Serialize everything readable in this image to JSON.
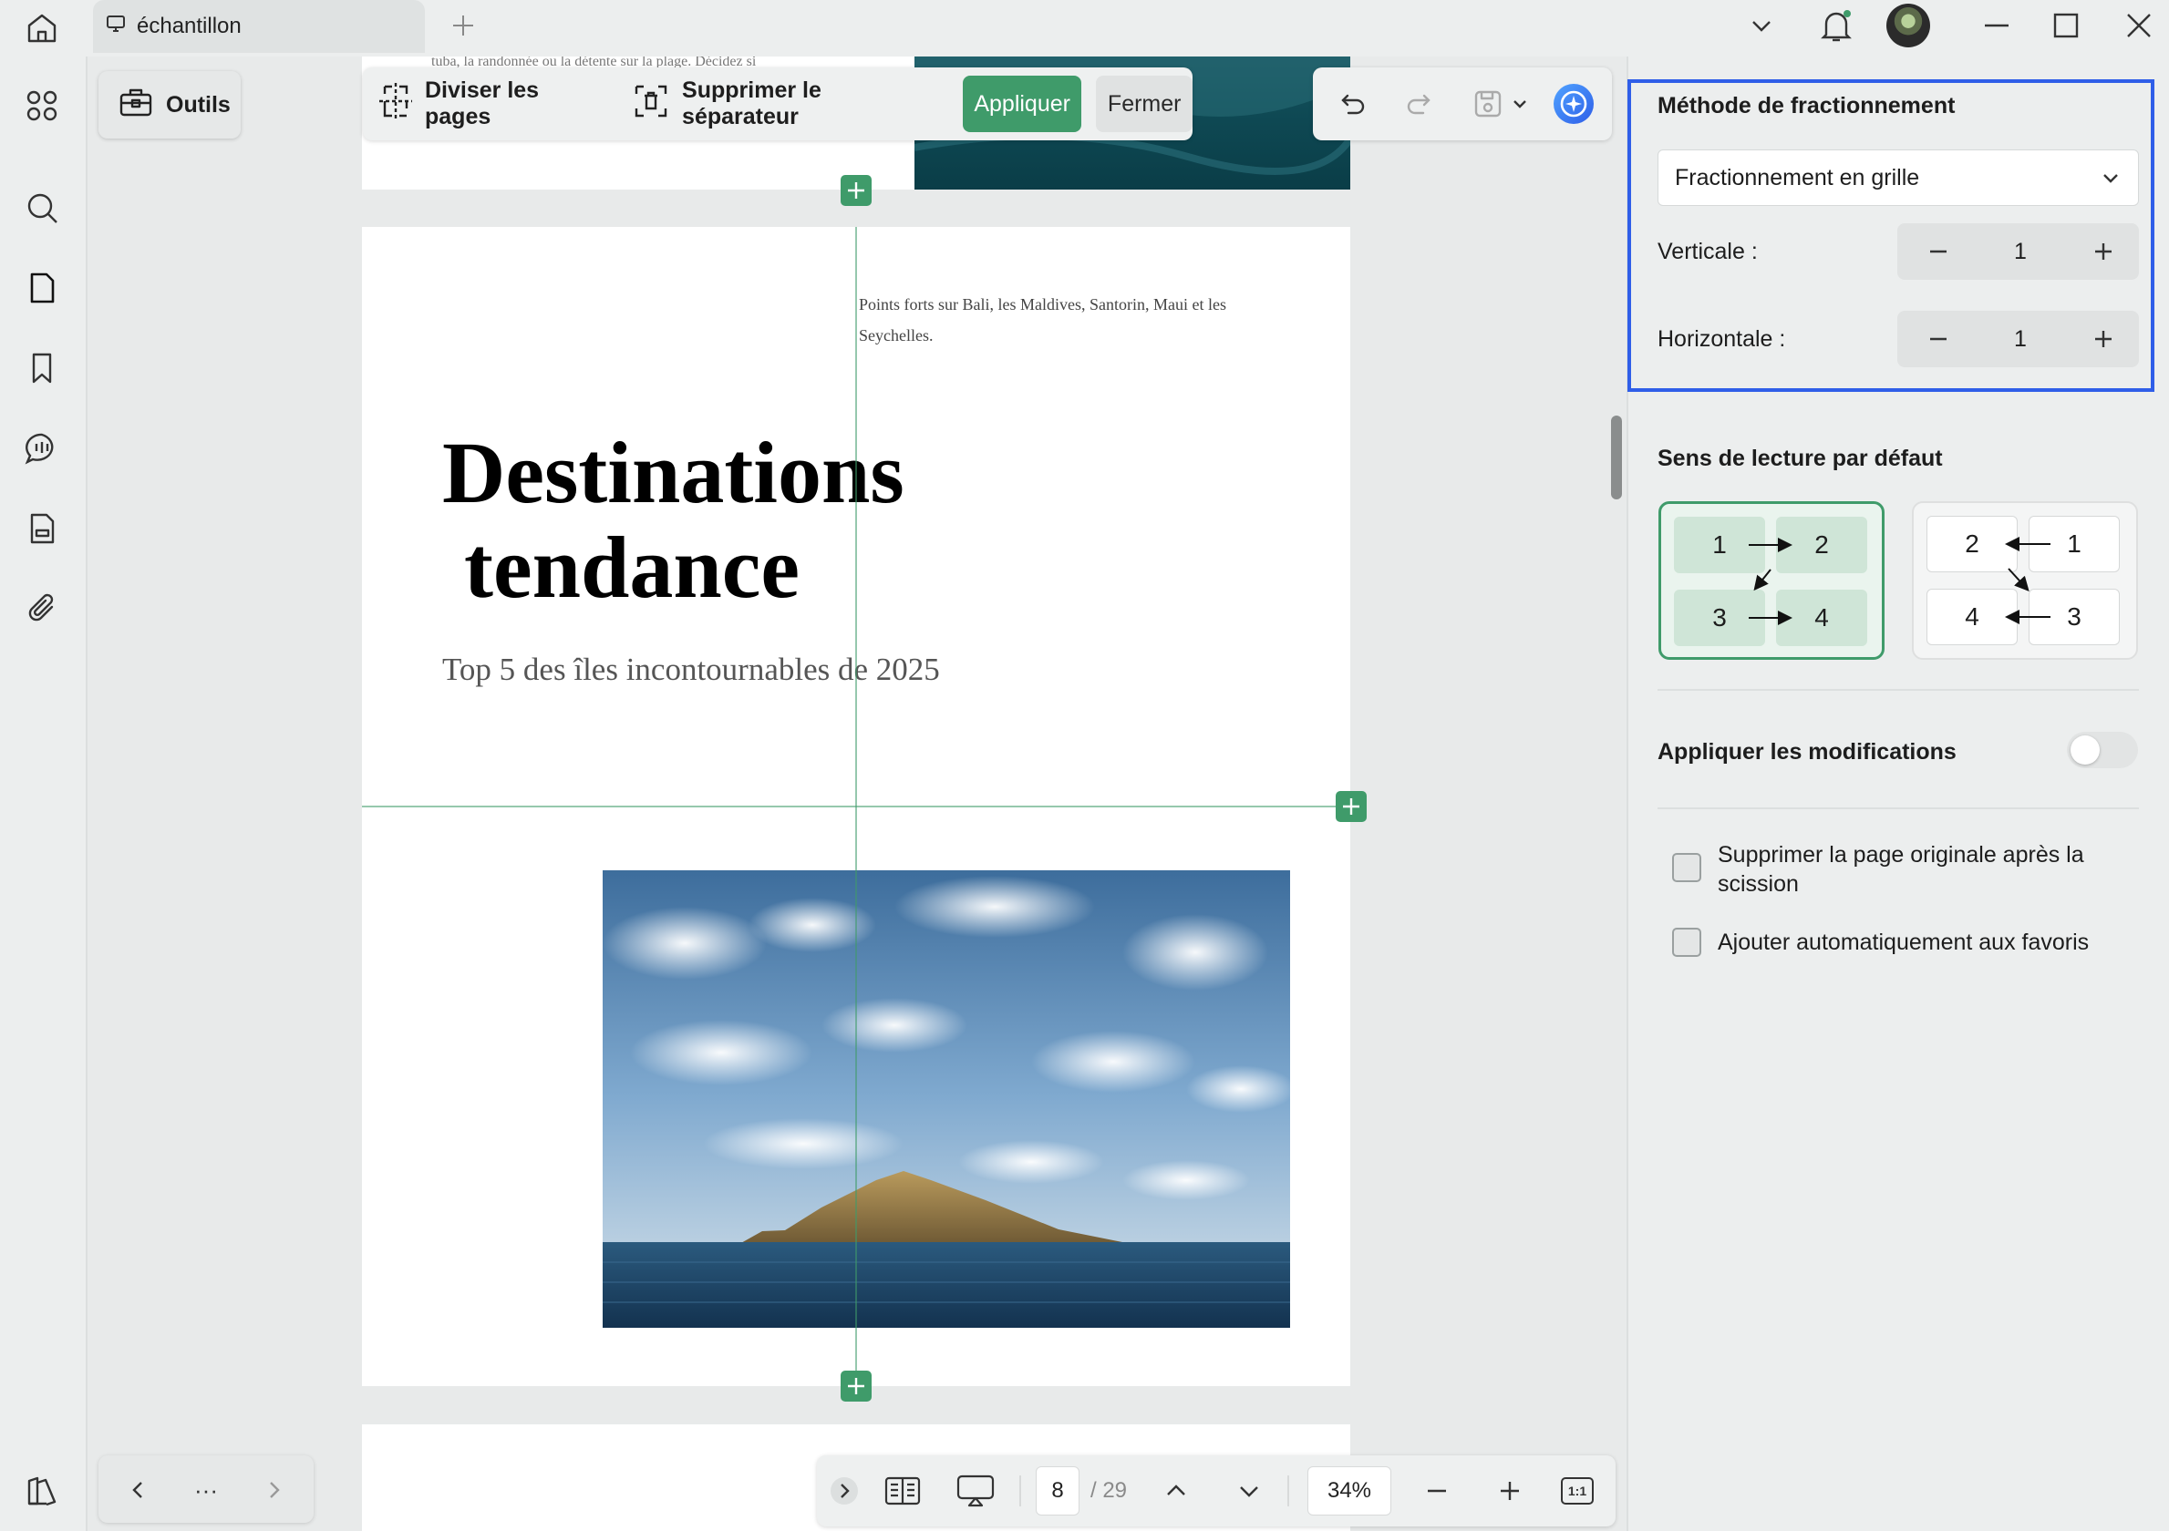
{
  "titlebar": {
    "tab_title": "échantillon"
  },
  "toolbar": {
    "tools_label": "Outils",
    "split_pages_label": "Diviser les pages",
    "remove_separator_label": "Supprimer le séparateur",
    "apply_label": "Appliquer",
    "close_label": "Fermer"
  },
  "document": {
    "top_page_snippet": "tuba, la randonnée ou la détente sur la plage. Décidez si",
    "top_note": "Points forts sur Bali, les Maldives, Santorin, Maui et les Seychelles.",
    "title_line1": "Destinations",
    "title_line2": "tendance",
    "subtitle": "Top 5 des îles incontournables de 2025"
  },
  "status": {
    "page_current": "8",
    "page_total": "/ 29",
    "zoom": "34%",
    "fit_label": "1:1"
  },
  "nav": {
    "more_label": "···"
  },
  "panel": {
    "split_method_heading": "Méthode de fractionnement",
    "split_method_value": "Fractionnement en grille",
    "vertical_label": "Verticale :",
    "vertical_value": "1",
    "horizontal_label": "Horizontale :",
    "horizontal_value": "1",
    "reading_order_heading": "Sens de lecture par défaut",
    "order_ltr": [
      "1",
      "2",
      "3",
      "4"
    ],
    "order_rtl": [
      "2",
      "1",
      "4",
      "3"
    ],
    "apply_changes_label": "Appliquer les modifications",
    "apply_changes_on": false,
    "delete_original_label": "Supprimer la page originale après la scission",
    "add_favorites_label": "Ajouter automatiquement aux favoris"
  },
  "colors": {
    "accent_green": "#3f9b6a",
    "highlight_blue": "#2f5ee8",
    "background": "#eceeee"
  }
}
